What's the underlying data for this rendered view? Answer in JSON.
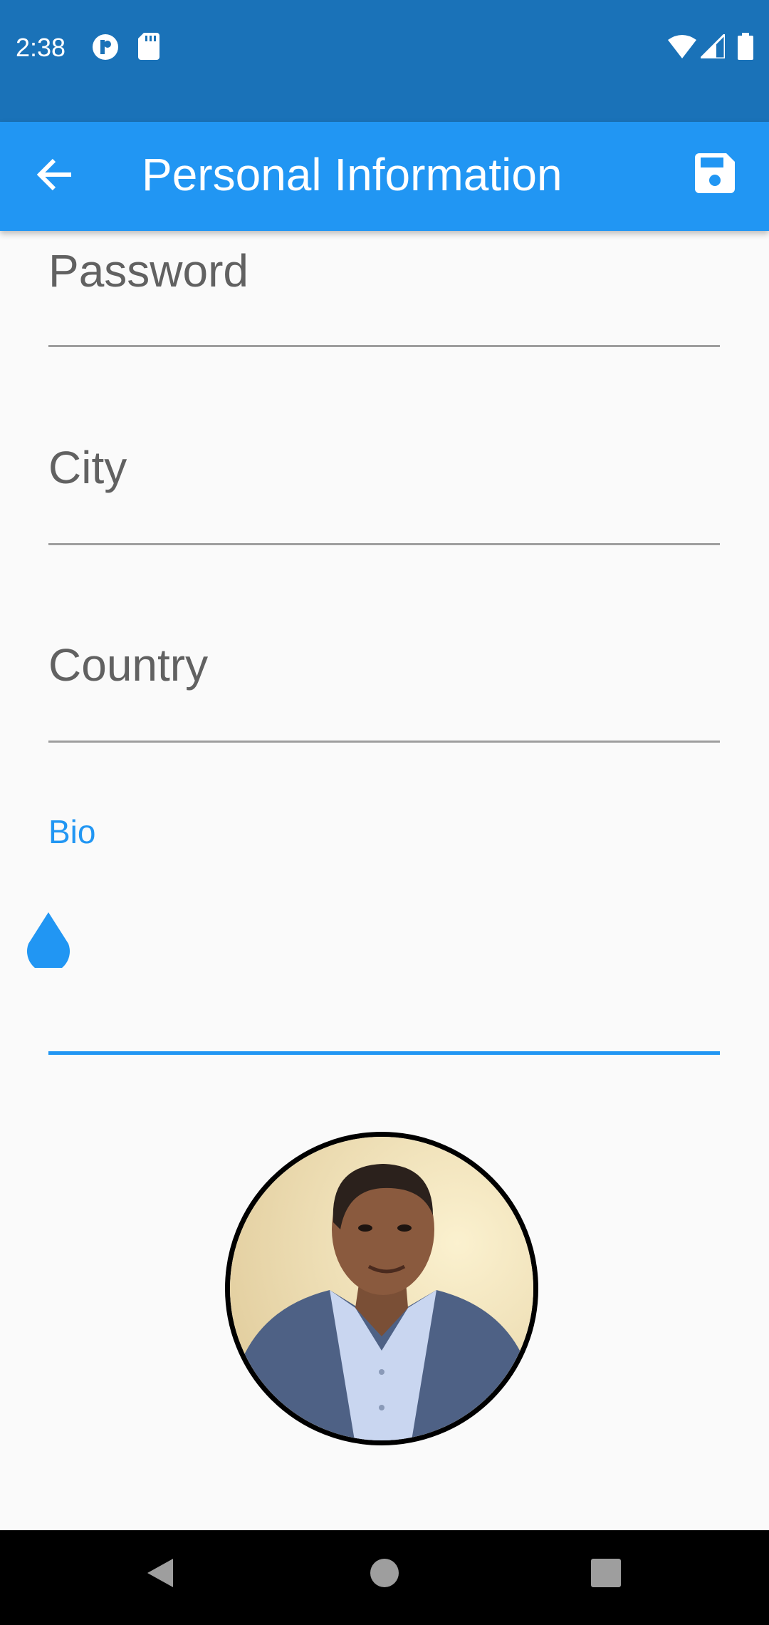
{
  "status_bar": {
    "time": "2:38",
    "icons": [
      "notification-p-icon",
      "sd-card-icon",
      "wifi-icon",
      "signal-icon",
      "battery-icon"
    ]
  },
  "app_bar": {
    "title": "Personal Information",
    "back_icon": "arrow-back-icon",
    "save_icon": "save-icon",
    "background": "#2196f3"
  },
  "form": {
    "fields": [
      {
        "label": "Password",
        "value": ""
      },
      {
        "label": "City",
        "value": ""
      },
      {
        "label": "Country",
        "value": ""
      }
    ],
    "bio": {
      "label": "Bio",
      "value": "",
      "focused": true,
      "accent": "#2196f3"
    }
  },
  "profile": {
    "avatar": "profile-photo"
  },
  "nav_bar": {
    "buttons": [
      "back-triangle-icon",
      "home-circle-icon",
      "recents-square-icon"
    ]
  }
}
